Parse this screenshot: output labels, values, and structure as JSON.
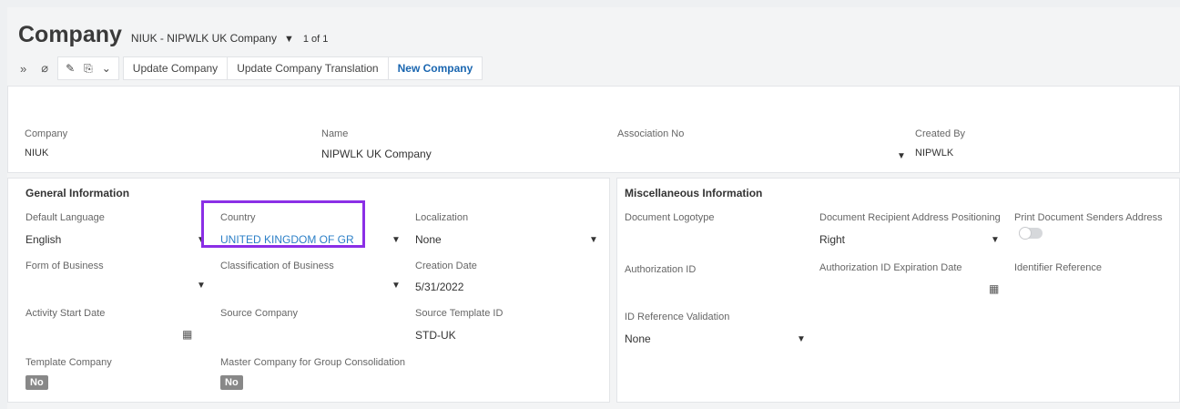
{
  "header": {
    "title": "Company",
    "record": "NIUK - NIPWLK UK Company",
    "caret": "▼",
    "count": "1 of 1"
  },
  "toolbar": {
    "expand_icon": "»",
    "attach_icon": "⌀",
    "edit_icon": "✎",
    "stamp_icon": "⎘",
    "dropdown_icon": "⌄",
    "update_company": "Update Company",
    "update_translation": "Update Company Translation",
    "new_company": "New Company"
  },
  "summary": {
    "company_label": "Company",
    "company_value": "NIUK",
    "name_label": "Name",
    "name_value": "NIPWLK UK Company",
    "association_label": "Association No",
    "created_by_label": "Created By",
    "created_by_value": "NIPWLK"
  },
  "general": {
    "title": "General Information",
    "default_language_label": "Default Language",
    "default_language_value": "English",
    "country_label": "Country",
    "country_value": "UNITED KINGDOM OF GR",
    "localization_label": "Localization",
    "localization_value": "None",
    "form_of_business_label": "Form of Business",
    "classification_label": "Classification of Business",
    "creation_date_label": "Creation Date",
    "creation_date_value": "5/31/2022",
    "activity_start_label": "Activity Start Date",
    "source_company_label": "Source Company",
    "source_template_label": "Source Template ID",
    "source_template_value": "STD-UK",
    "template_company_label": "Template Company",
    "template_company_value": "No",
    "master_company_label": "Master Company for Group Consolidation",
    "master_company_value": "No"
  },
  "misc": {
    "title": "Miscellaneous Information",
    "logotype_label": "Document Logotype",
    "recipient_pos_label": "Document Recipient Address Positioning",
    "recipient_pos_value": "Right",
    "print_senders_label": "Print Document Senders Address",
    "auth_id_label": "Authorization ID",
    "auth_exp_label": "Authorization ID Expiration Date",
    "identifier_ref_label": "Identifier Reference",
    "id_ref_validation_label": "ID Reference Validation",
    "id_ref_validation_value": "None"
  },
  "colors": {
    "accent": "#1a66b0",
    "link": "#2b7fc7",
    "highlight": "#8b2fe6"
  }
}
